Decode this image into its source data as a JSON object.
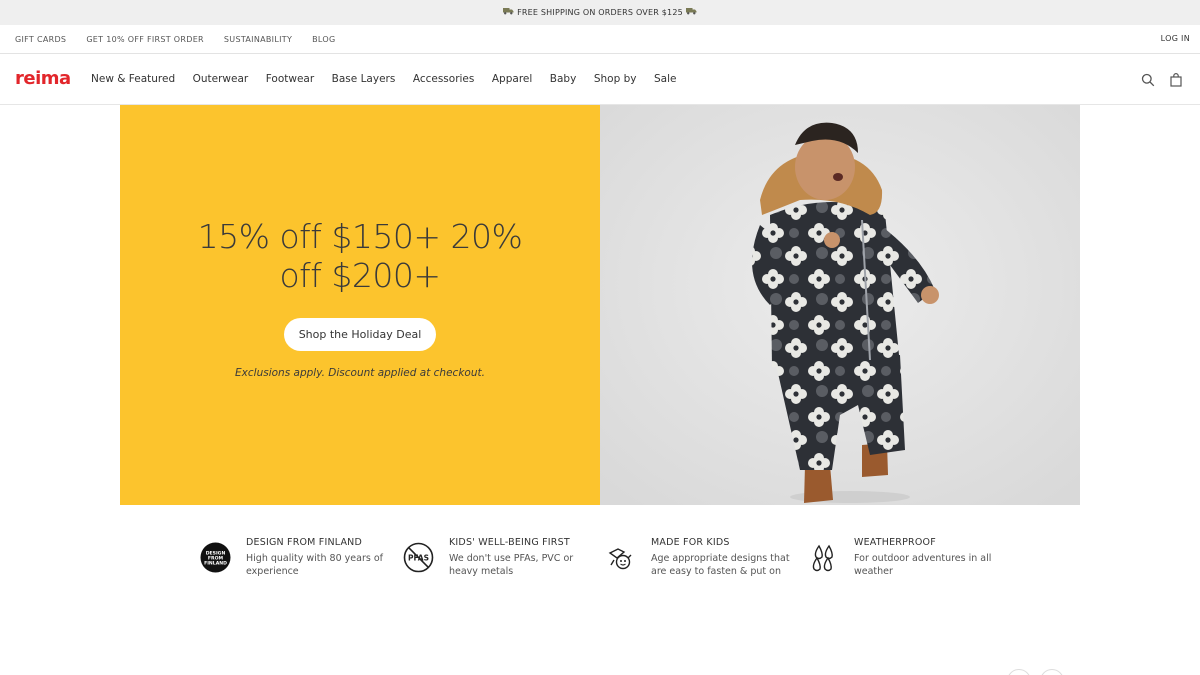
{
  "announcement": {
    "text": "FREE SHIPPING ON ORDERS OVER $125"
  },
  "utility_nav": {
    "links": [
      "GIFT CARDS",
      "GET 10% OFF FIRST ORDER",
      "SUSTAINABILITY",
      "BLOG"
    ],
    "login": "LOG IN"
  },
  "brand": {
    "logo": "reima",
    "color": "#e2262b"
  },
  "main_nav": {
    "items": [
      "New & Featured",
      "Outerwear",
      "Footwear",
      "Base Layers",
      "Accessories",
      "Apparel",
      "Baby",
      "Shop by",
      "Sale"
    ],
    "icons": [
      "search-icon",
      "shopping-bag-icon"
    ]
  },
  "hero": {
    "title_line1": "15% off $150+ 20%",
    "title_line2": "off $200+",
    "cta": "Shop the Holiday Deal",
    "note": "Exclusions apply. Discount applied at checkout.",
    "bg_color": "#fcc42d"
  },
  "features": [
    {
      "icon": "design-from-finland-badge-icon",
      "badge_text": "DESIGN FROM FINLAND",
      "title": "DESIGN FROM FINLAND",
      "desc": "High quality with 80 years of experience"
    },
    {
      "icon": "no-pfas-icon",
      "badge_text": "PFAS",
      "title": "KIDS' WELL-BEING FIRST",
      "desc": "We don't use PFAs, PVC or heavy metals"
    },
    {
      "icon": "made-for-kids-icon",
      "title": "MADE FOR KIDS",
      "desc": "Age appropriate designs that are easy to fasten & put on"
    },
    {
      "icon": "raindrops-icon",
      "title": "WEATHERPROOF",
      "desc": "For outdoor adventures in all weather"
    }
  ]
}
